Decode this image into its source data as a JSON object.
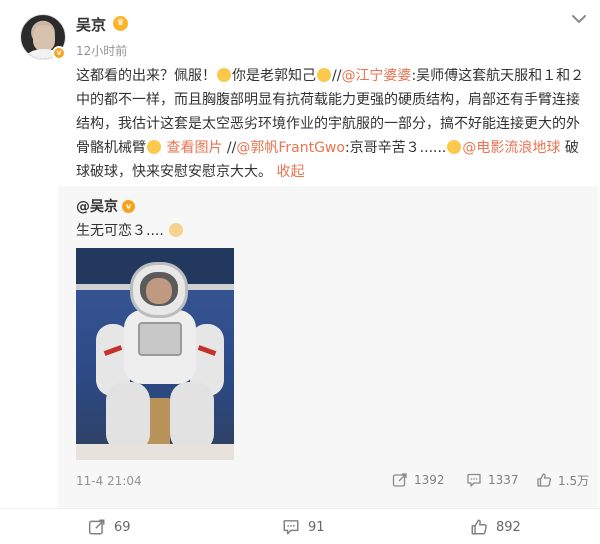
{
  "author": {
    "name": "吴京",
    "time": "12小时前"
  },
  "post": {
    "segments": [
      {
        "text": "这都看的出来？佩服！",
        "type": "text"
      },
      {
        "text": "",
        "type": "emoji"
      },
      {
        "text": "你是老郭知己",
        "type": "text"
      },
      {
        "text": "",
        "type": "emoji"
      },
      {
        "text": "//",
        "type": "text"
      },
      {
        "text": "@江宁婆婆",
        "type": "hl"
      },
      {
        "text": ":吴师傅这套航天服和１和２中的都不一样，而且胸腹部明显有抗荷载能力更强的硬质结构，肩部还有手臂连接结构，我估计这套是太空恶劣环境作业的宇航服的一部分，搞不好能连接更大的外骨骼机械臂",
        "type": "text"
      },
      {
        "text": "",
        "type": "emoji"
      },
      {
        "text": " ",
        "type": "text"
      },
      {
        "text": "查看图片",
        "type": "hl"
      },
      {
        "text": " //",
        "type": "text"
      },
      {
        "text": "@郭帆FrantGwo",
        "type": "hl"
      },
      {
        "text": ":京哥辛苦３......",
        "type": "text"
      },
      {
        "text": "",
        "type": "emoji"
      },
      {
        "text": "@电影流浪地球",
        "type": "hl"
      },
      {
        "text": " 破球破球，快来安慰安慰京大大。 ",
        "type": "text"
      },
      {
        "text": "收起",
        "type": "hl"
      }
    ]
  },
  "repost": {
    "author": "@吴京",
    "text": "生无可恋３....",
    "date": "11-4 21:04",
    "shares": "1392",
    "comments": "1337",
    "likes": "1.5万"
  },
  "footer": {
    "shares": "69",
    "comments": "91",
    "likes": "892"
  },
  "icons": {
    "menu": "chevron-down-icon",
    "share": "share-icon",
    "comment": "comment-icon",
    "like": "thumbs-up-icon"
  },
  "colors": {
    "link": "#eb7350",
    "badge": "#f7a21b"
  }
}
